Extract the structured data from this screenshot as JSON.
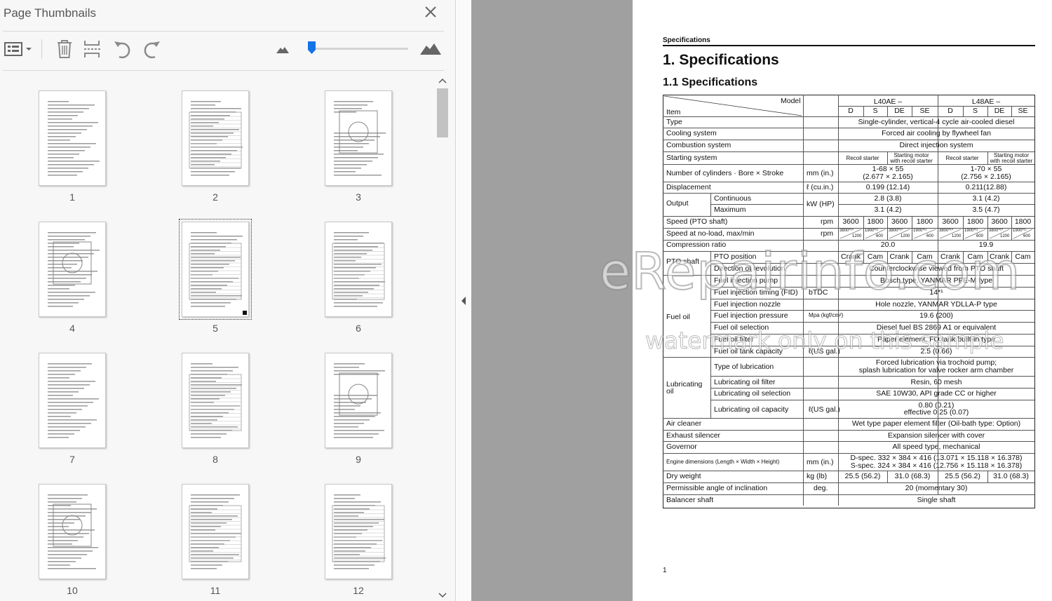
{
  "panel": {
    "title": "Page Thumbnails",
    "toolbar_icons": [
      "thumbnail-options-icon",
      "delete-pages-icon",
      "insert-pages-icon",
      "rotate-counterclockwise-icon",
      "rotate-clockwise-icon",
      "zoom-out-mountain-icon",
      "zoom-in-mountain-icon"
    ],
    "zoom_level_fraction": 0.03,
    "thumbnails": [
      {
        "label": "1"
      },
      {
        "label": "2"
      },
      {
        "label": "3"
      },
      {
        "label": "4"
      },
      {
        "label": "5",
        "selected": true
      },
      {
        "label": "6"
      },
      {
        "label": "7"
      },
      {
        "label": "8"
      },
      {
        "label": "9"
      },
      {
        "label": "10"
      },
      {
        "label": "11"
      },
      {
        "label": "12"
      }
    ]
  },
  "document": {
    "running_header": "Specifications",
    "heading1": "1.  Specifications",
    "heading2": "1.1   Specifications",
    "page_number": "1",
    "table": {
      "header": {
        "model": "Model",
        "item": "Item",
        "l40": "L40AE –",
        "l48": "L48AE –",
        "variants": [
          "D",
          "S",
          "DE",
          "SE",
          "D",
          "S",
          "DE",
          "SE"
        ]
      },
      "rows": {
        "type": {
          "item": "Type",
          "value": "Single-cylinder, vertical-4 cycle air-cooled diesel"
        },
        "cooling": {
          "item": "Cooling system",
          "value": "Forced air cooling by flywheel fan"
        },
        "combustion": {
          "item": "Combustion system",
          "value": "Direct injection system"
        },
        "starting": {
          "item": "Starting system",
          "v1": "Recoil starter",
          "v2a": "Starting motor",
          "v2b": "with recoil starter",
          "v3": "Recoil starter",
          "v4a": "Starting motor",
          "v4b": "with recoil starter"
        },
        "cylinders": {
          "item": "Number of cylinders · Bore × Stroke",
          "unit": "mm (in.)",
          "l40a": "1-68 × 55",
          "l40b": "(2.677 × 2.165)",
          "l48a": "1-70 × 55",
          "l48b": "(2.756 × 2.165)"
        },
        "displacement": {
          "item": "Displacement",
          "unit": "ℓ (cu.in.)",
          "l40": "0.199 (12.14)",
          "l48": "0.211(12.88)"
        },
        "output": {
          "item": "Output",
          "sub1": "Continuous",
          "sub2": "Maximum",
          "unit": "kW (HP)",
          "c40": "2.8 (3.8)",
          "c48": "3.1 (4.2)",
          "m40": "3.1 (4.2)",
          "m48": "3.5 (4.7)"
        },
        "speed": {
          "item": "Speed (PTO shaft)",
          "unit": "rpm",
          "values": [
            "3600",
            "1800",
            "3600",
            "1800",
            "3600",
            "1800",
            "3600",
            "1800"
          ]
        },
        "noload": {
          "item": "Speed at no-load, max/min",
          "unit": "rpm",
          "tops": [
            "3800*¹⁰",
            "1900*¹¹",
            "3800*¹⁰",
            "1900*¹¹",
            "3800*¹⁰",
            "1900*¹¹",
            "3800*¹⁰",
            "1900*¹¹"
          ],
          "bots": [
            "1200",
            "600",
            "1200",
            "600",
            "1200",
            "600",
            "1200",
            "600"
          ]
        },
        "compression": {
          "item": "Compression ratio",
          "l40": "20.0",
          "l48": "19.9"
        },
        "pto": {
          "group": "PTO shaft",
          "pos": "PTO position",
          "dir": "Direction of revolution",
          "positions": [
            "Crank",
            "Cam",
            "Crank",
            "Cam",
            "Crank",
            "Cam",
            "Crank",
            "Cam"
          ],
          "dir_val": "Counterclockwise viewed from PTO shaft"
        },
        "fuel": {
          "group": "Fuel oil",
          "pump": "Fuel injection pump",
          "pump_val": "Bosch type, YANMAR PFE-M type",
          "timing": "Fuel injection timing (FID)",
          "timing_unit": "bTDC",
          "timing_val": "14*¹",
          "nozzle": "Fuel injection nozzle",
          "nozzle_val": "Hole nozzle, YANMAR YDLLA-P type",
          "pressure": "Fuel injection pressure",
          "pressure_unit": "Mpa (kgf/cm²)",
          "pressure_val": "19.6 (200)",
          "selection": "Fuel oil selection",
          "selection_val": "Diesel fuel BS 2869 A1 or equivalent",
          "filter": "Fuel oil filter",
          "filter_val": "Paper element, FO tank built-in type",
          "tank": "Fuel oil tank capacity",
          "tank_unit": "ℓ(US gal.)",
          "tank_val": "2.5 (0.66)"
        },
        "lube": {
          "group1": "Lubricating",
          "group2": "oil",
          "type": "Type of lubrication",
          "type_val1": "Forced lubrication via trochoid pump;",
          "type_val2": "splash lubrication for valve rocker arm chamber",
          "filter": "Lubricating oil filter",
          "filter_val": "Resin, 60 mesh",
          "selection": "Lubricating oil selection",
          "selection_val": "SAE 10W30, API grade CC or higher",
          "capacity": "Lubricating oil capacity",
          "capacity_unit": "ℓ(US gal.)",
          "capacity_val1": "0.80 (0.21)",
          "capacity_val2": "effective 0.25 (0.07)"
        },
        "air": {
          "item": "Air cleaner",
          "value": "Wet type paper element filter (Oil-bath type: Option)"
        },
        "exhaust": {
          "item": "Exhaust silencer",
          "value": "Expansion silencer with cover"
        },
        "governor": {
          "item": "Governor",
          "value": "All speed type, mechanical"
        },
        "dimensions": {
          "item": "Engine dimensions (Length × Width × Height)",
          "unit": "mm (in.)",
          "d": "D-spec.  332 × 384 × 416 (13.071 × 15.118 × 16.378)",
          "s": "S-spec.  324 × 384 × 416 (12.756 × 15.118 × 16.378)"
        },
        "weight": {
          "item": "Dry weight",
          "unit": "kg (lb)",
          "values": [
            "25.5 (56.2)",
            "31.0 (68.3)",
            "25.5 (56.2)",
            "31.0 (68.3)"
          ]
        },
        "incline": {
          "item": "Permissible angle of inclination",
          "unit": "deg.",
          "value": "20 (momentary 30)"
        },
        "balancer": {
          "item": "Balancer shaft",
          "value": "Single shaft"
        }
      }
    },
    "watermark1": "eRepairinfo.com",
    "watermark2": "watermark only on this sample"
  }
}
